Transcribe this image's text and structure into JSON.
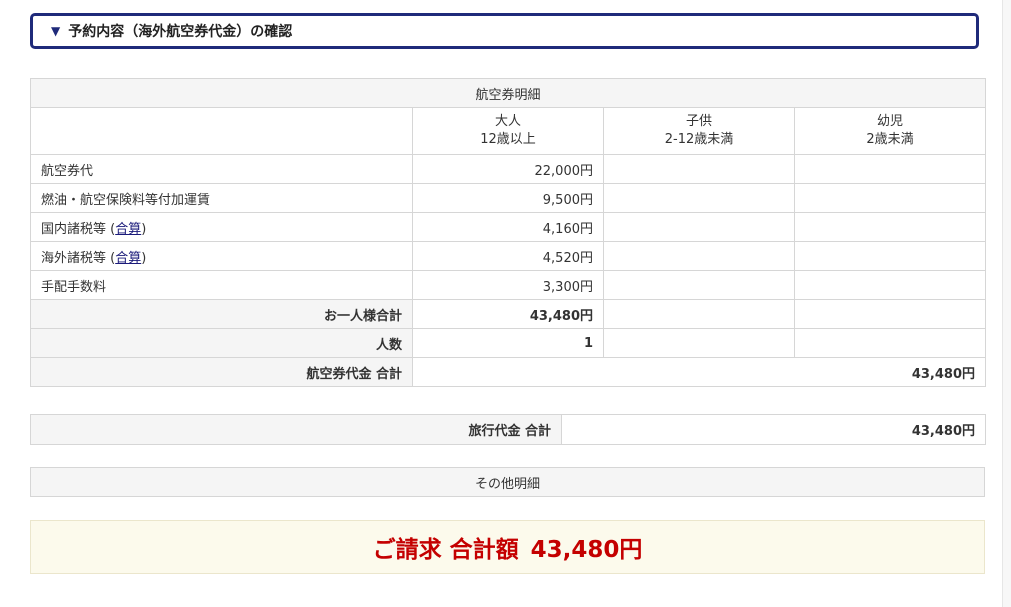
{
  "header": {
    "title": "予約内容（海外航空券代金）の確認"
  },
  "fare_table": {
    "caption": "航空券明細",
    "columns": [
      {
        "line1": "大人",
        "line2": "12歳以上"
      },
      {
        "line1": "子供",
        "line2": "2-12歳未満"
      },
      {
        "line1": "幼児",
        "line2": "2歳未満"
      }
    ],
    "rows": [
      {
        "label": "航空券代",
        "link": "",
        "suffix": "",
        "adult": "22,000円"
      },
      {
        "label": "燃油・航空保険料等付加運賃",
        "link": "",
        "suffix": "",
        "adult": "9,500円"
      },
      {
        "label": "国内諸税等 (",
        "link": "合算",
        "suffix": ")",
        "adult": "4,160円"
      },
      {
        "label": "海外諸税等 (",
        "link": "合算",
        "suffix": ")",
        "adult": "4,520円"
      },
      {
        "label": "手配手数料",
        "link": "",
        "suffix": "",
        "adult": "3,300円"
      }
    ],
    "per_person_label": "お一人様合計",
    "per_person_adult": "43,480円",
    "count_label": "人数",
    "count_adult": "1",
    "total_label": "航空券代金 合計",
    "total_value": "43,480円"
  },
  "travel_total": {
    "label": "旅行代金 合計",
    "value": "43,480円"
  },
  "other": {
    "caption": "その他明細"
  },
  "billing": {
    "label": "ご請求 合計額",
    "value": "43,480円"
  }
}
